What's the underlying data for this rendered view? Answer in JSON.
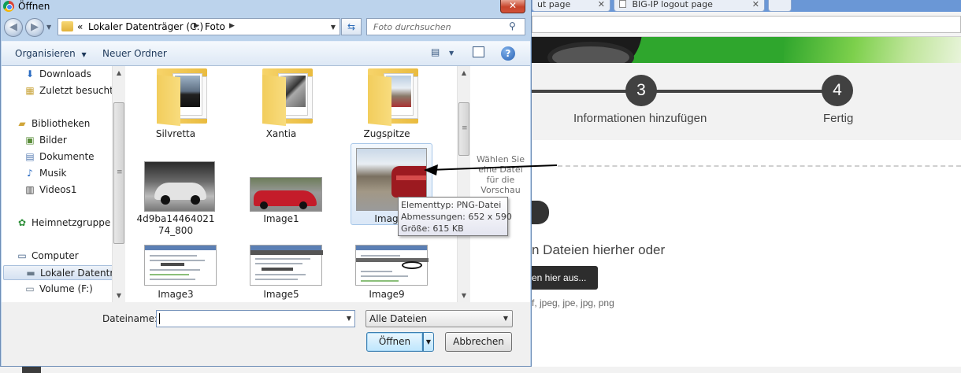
{
  "browser": {
    "tabs": [
      {
        "title": "ut page"
      },
      {
        "title": "BIG-IP logout page"
      }
    ]
  },
  "webpage": {
    "steps": [
      {
        "number": "3",
        "label": "Informationen hinzufügen"
      },
      {
        "number": "4",
        "label": "Fertig"
      }
    ],
    "drop_text": "n Dateien hierher oder",
    "choose_button": "en hier aus...",
    "formats": "f, jpeg, jpe, jpg, png"
  },
  "dialog": {
    "title": "Öffnen",
    "close_label": "✕",
    "address": {
      "prefix": "«",
      "segments": [
        "Lokaler Datenträger (C:)",
        "Foto"
      ]
    },
    "search_placeholder": "Foto durchsuchen",
    "toolbar": {
      "organize": "Organisieren",
      "new_folder": "Neuer Ordner"
    },
    "nav_items": [
      {
        "label": "Downloads",
        "icon": "downloads-icon"
      },
      {
        "label": "Zuletzt besucht",
        "icon": "recent-places-icon"
      },
      {
        "label": "Bibliotheken",
        "icon": "libraries-icon"
      },
      {
        "label": "Bilder",
        "icon": "pictures-icon"
      },
      {
        "label": "Dokumente",
        "icon": "documents-icon"
      },
      {
        "label": "Musik",
        "icon": "music-icon"
      },
      {
        "label": "Videos1",
        "icon": "videos-icon"
      },
      {
        "label": "Heimnetzgruppe",
        "icon": "homegroup-icon"
      },
      {
        "label": "Computer",
        "icon": "computer-icon"
      },
      {
        "label": "Lokaler Datenträger",
        "icon": "local-disk-icon",
        "selected": true
      },
      {
        "label": "Volume (F:)",
        "icon": "drive-icon"
      }
    ],
    "files": [
      {
        "name": "Silvretta",
        "kind": "folder"
      },
      {
        "name": "Xantia",
        "kind": "folder"
      },
      {
        "name": "Zugspitze",
        "kind": "folder"
      },
      {
        "name": "4d9ba1446402174_800",
        "kind": "photo-bw-car"
      },
      {
        "name": "Image1",
        "kind": "photo-red-car"
      },
      {
        "name": "Image2",
        "kind": "photo-mountain-car",
        "hovered": true
      },
      {
        "name": "Image3",
        "kind": "screenshot"
      },
      {
        "name": "Image5",
        "kind": "screenshot"
      },
      {
        "name": "Image9",
        "kind": "screenshot"
      }
    ],
    "tooltip": {
      "type": "Elementtyp: PNG-Datei",
      "dimensions": "Abmessungen: 652 x 590",
      "size": "Größe: 615 KB"
    },
    "preview_text": "Wählen Sie eine Datei für die Vorschau",
    "filename_label": "Dateiname:",
    "filename_value": "",
    "filetype_value": "Alle Dateien",
    "open_button": "Öffnen",
    "cancel_button": "Abbrechen"
  }
}
